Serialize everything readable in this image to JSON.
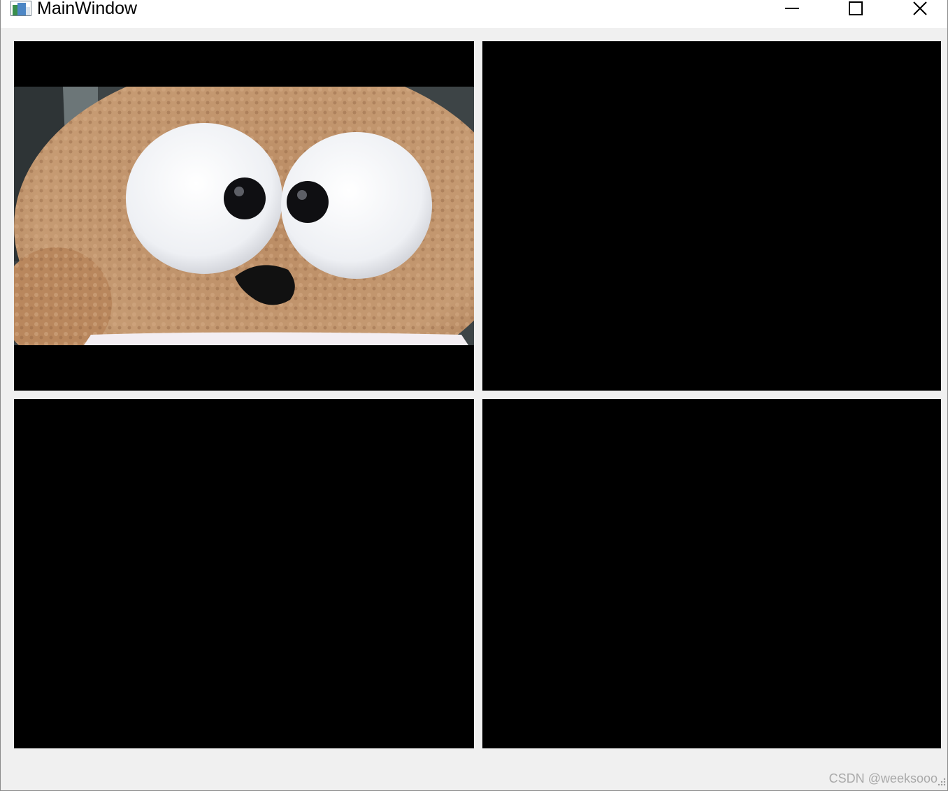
{
  "window": {
    "title": "MainWindow",
    "icon": "app-window-icon",
    "controls": {
      "minimize_icon": "minimize-icon",
      "maximize_icon": "maximize-icon",
      "close_icon": "close-icon"
    }
  },
  "video_panels": [
    {
      "id": "panel-1",
      "state": "live",
      "content": "camera-feed"
    },
    {
      "id": "panel-2",
      "state": "empty"
    },
    {
      "id": "panel-3",
      "state": "empty"
    },
    {
      "id": "panel-4",
      "state": "empty"
    }
  ],
  "watermark": "CSDN @weeksooo",
  "colors": {
    "window_bg": "#f0f0f0",
    "titlebar_bg": "#ffffff",
    "panel_bg": "#000000"
  }
}
